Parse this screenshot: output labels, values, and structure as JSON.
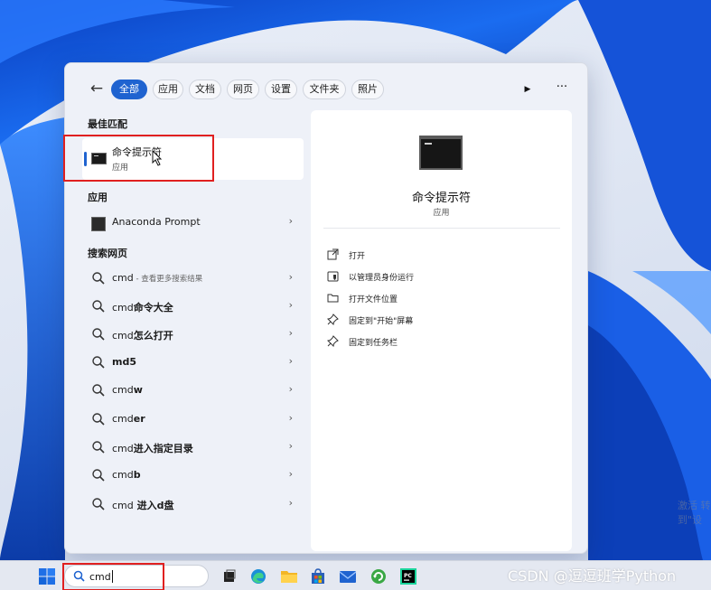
{
  "filters": {
    "chips": [
      {
        "label": "全部",
        "active": true
      },
      {
        "label": "应用",
        "active": false
      },
      {
        "label": "文档",
        "active": false
      },
      {
        "label": "网页",
        "active": false
      },
      {
        "label": "设置",
        "active": false
      },
      {
        "label": "文件夹",
        "active": false
      },
      {
        "label": "照片",
        "active": false
      }
    ],
    "back_icon": "back-arrow-icon",
    "play_icon": "play-icon",
    "more_icon": "more-dots-icon"
  },
  "best_match": {
    "section": "最佳匹配",
    "name": "命令提示符",
    "type": "应用"
  },
  "apps": {
    "section": "应用",
    "items": [
      {
        "label": "Anaconda Prompt"
      }
    ]
  },
  "web": {
    "section": "搜索网页",
    "first": {
      "query": "cmd",
      "hint": " - 查看更多搜索结果"
    },
    "items": [
      {
        "typed": "cmd",
        "rest": "命令大全"
      },
      {
        "typed": "cmd",
        "rest": "怎么打开"
      },
      {
        "typed": "",
        "rest": "md5"
      },
      {
        "typed": "cmd",
        "rest": "w"
      },
      {
        "typed": "cmd",
        "rest": "er"
      },
      {
        "typed": "cmd",
        "rest": "进入指定目录"
      },
      {
        "typed": "cmd",
        "rest": "b"
      },
      {
        "typed": "cmd",
        "rest": " 进入d盘"
      }
    ]
  },
  "preview": {
    "title": "命令提示符",
    "type": "应用",
    "actions": [
      {
        "label": "打开",
        "icon": "open-external-icon"
      },
      {
        "label": "以管理员身份运行",
        "icon": "shield-admin-icon"
      },
      {
        "label": "打开文件位置",
        "icon": "folder-icon"
      },
      {
        "label": "固定到\"开始\"屏幕",
        "icon": "pin-icon"
      },
      {
        "label": "固定到任务栏",
        "icon": "pin-icon"
      }
    ]
  },
  "taskbar": {
    "search_value": "cmd",
    "credit": "CSDN @逗逗班学Python",
    "watermark": "激活\n转到\"设"
  },
  "colors": {
    "accent": "#1f63d0",
    "highlight_box": "#e02020"
  }
}
